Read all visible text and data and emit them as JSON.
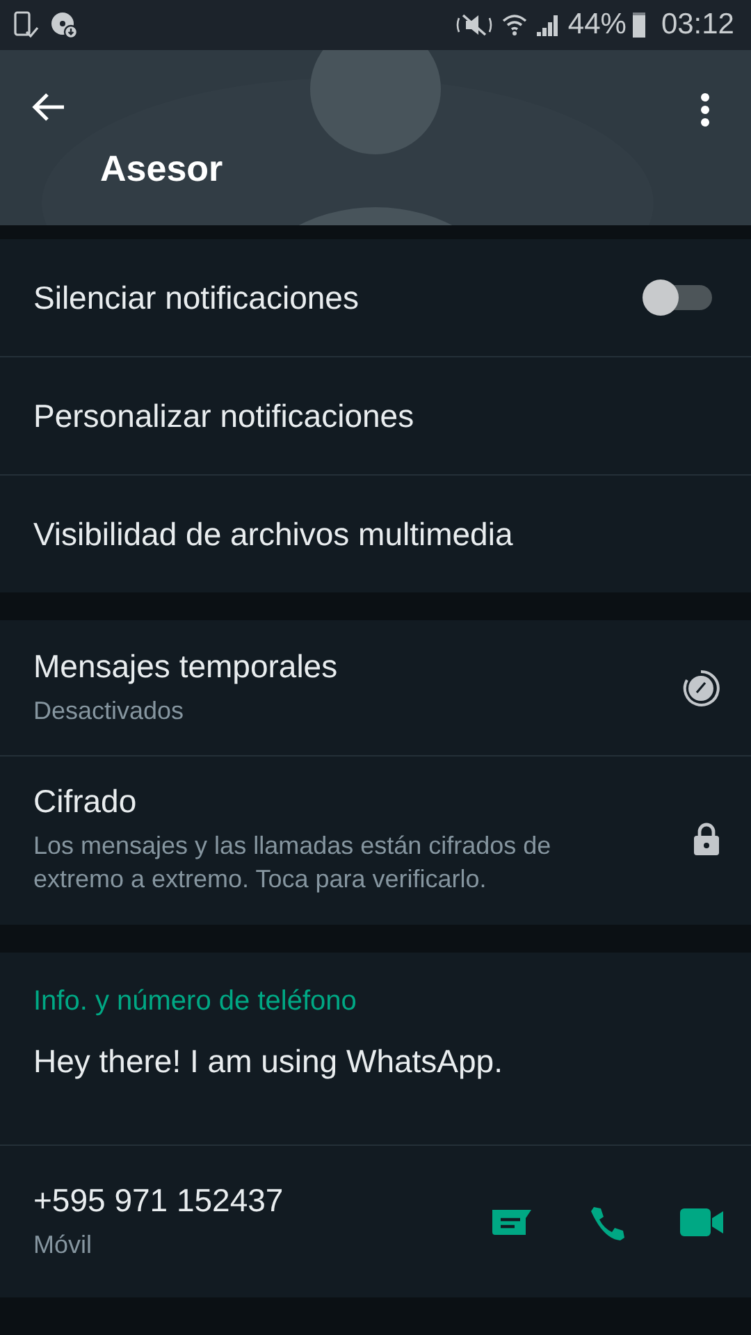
{
  "status_bar": {
    "battery": "44%",
    "time": "03:12"
  },
  "header": {
    "title": "Asesor"
  },
  "sections": [
    {
      "items": [
        {
          "kind": "toggle",
          "label": "Silenciar notificaciones",
          "on": false
        },
        {
          "kind": "plain",
          "label": "Personalizar notificaciones"
        },
        {
          "kind": "plain",
          "label": "Visibilidad de archivos multimedia"
        }
      ]
    },
    {
      "items": [
        {
          "kind": "timer",
          "label": "Mensajes temporales",
          "sublabel": "Desactivados"
        },
        {
          "kind": "lock",
          "label": "Cifrado",
          "sublabel": "Los mensajes y las llamadas están cifrados de extremo a extremo. Toca para verificarlo."
        }
      ]
    }
  ],
  "about": {
    "heading": "Info. y número de teléfono",
    "status": "Hey there! I am using WhatsApp."
  },
  "phone": {
    "number": "+595 971 152437",
    "type": "Móvil"
  }
}
